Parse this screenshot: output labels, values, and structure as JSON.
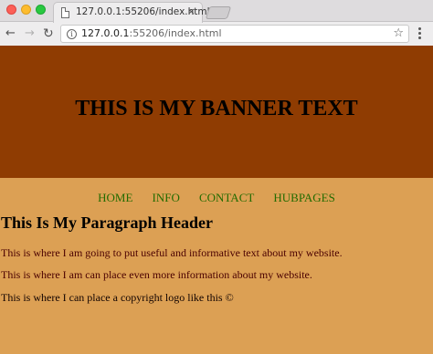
{
  "browser": {
    "tab_title": "127.0.0.1:55206/index.html",
    "tab_close": "×",
    "url_host": "127.0.0.1",
    "url_rest": ":55206/index.html",
    "back_glyph": "←",
    "forward_glyph": "→",
    "reload_glyph": "↻",
    "star_glyph": "☆",
    "info_glyph": "i"
  },
  "page": {
    "banner_text": "THIS IS MY BANNER TEXT",
    "nav": {
      "home": "HOME",
      "info": "INFO",
      "contact": "CONTACT",
      "hubpages": "HUBPAGES"
    },
    "paragraph_header": "This Is My Paragraph Header",
    "paragraphs": [
      "This is where I am going to put useful and informative text about my website.",
      "This is where I am can place even more information about my website.",
      "This is where I can place a copyright logo like this ©"
    ]
  },
  "colors": {
    "banner_bg": "#8f3c02",
    "page_bg": "#dca054",
    "nav_link": "#236b00",
    "paragraph_text": "#4a0000"
  }
}
